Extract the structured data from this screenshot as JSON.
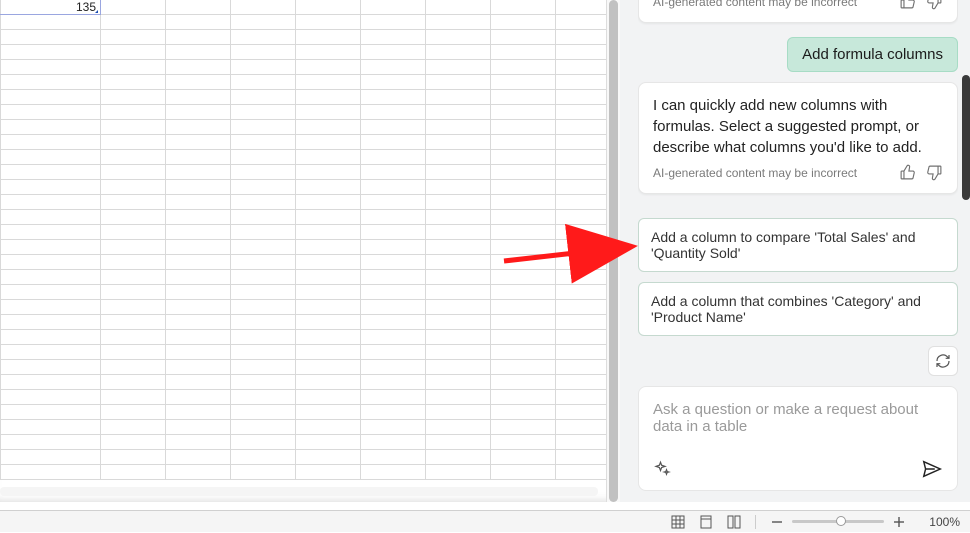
{
  "sheet": {
    "cell_value": "135",
    "row_count": 32
  },
  "pane": {
    "top_disclaimer": "AI-generated content may be incorrect",
    "user_message": "Add formula columns",
    "assistant": {
      "text": "I can quickly add new columns with formulas. Select a suggested prompt, or describe what columns you'd like to add.",
      "disclaimer": "AI-generated content may be incorrect"
    },
    "suggestions": [
      "Add a column to compare 'Total Sales' and 'Quantity Sold'",
      "Add a column that combines 'Category' and 'Product Name'"
    ],
    "input_placeholder": "Ask a question or make a request about data in a table"
  },
  "status": {
    "zoom": "100%"
  }
}
